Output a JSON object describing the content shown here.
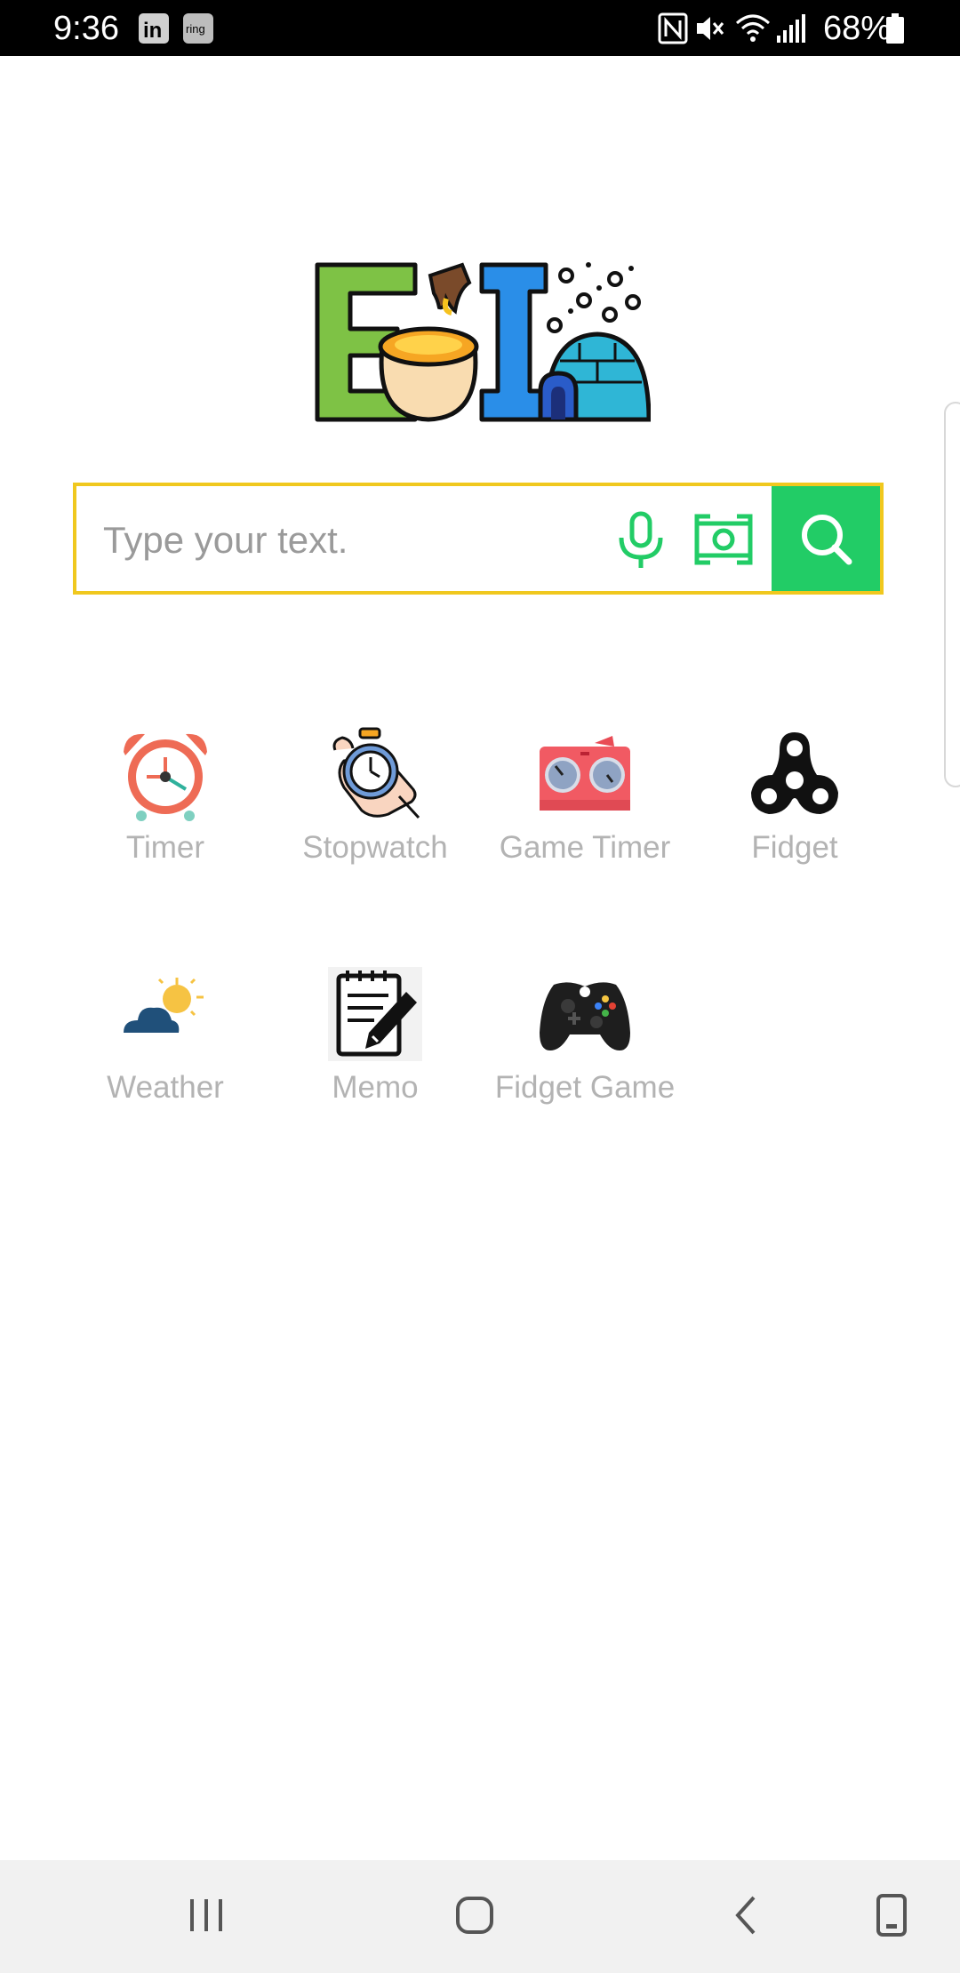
{
  "status_bar": {
    "time": "9:36",
    "notif_icons": [
      "linkedin-icon",
      "ring-icon"
    ],
    "ring_text": "ring",
    "status_icons": [
      "nfc-icon",
      "mute-icon",
      "wifi-icon",
      "signal-icon"
    ],
    "battery": "68%"
  },
  "search": {
    "placeholder": "Type your text.",
    "accent_color": "#22cc66",
    "border_color": "#f0c81e"
  },
  "apps": [
    {
      "label": "Timer",
      "icon": "alarm-clock-icon"
    },
    {
      "label": "Stopwatch",
      "icon": "stopwatch-icon"
    },
    {
      "label": "Game Timer",
      "icon": "game-timer-icon"
    },
    {
      "label": "Fidget",
      "icon": "fidget-spinner-icon"
    },
    {
      "label": "Weather",
      "icon": "weather-icon"
    },
    {
      "label": "Memo",
      "icon": "memo-icon"
    },
    {
      "label": "Fidget Game",
      "icon": "gamepad-icon"
    }
  ],
  "nav": {
    "buttons": [
      "recents-icon",
      "home-icon",
      "back-icon",
      "rotate-icon"
    ]
  }
}
